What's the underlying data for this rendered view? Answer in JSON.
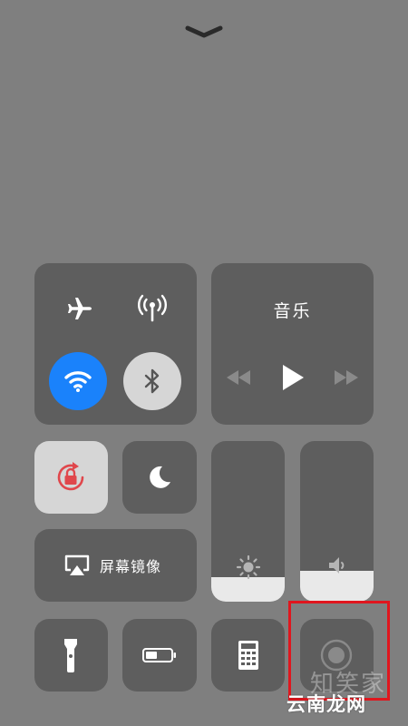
{
  "control_center": {
    "handle_icon": "chevron-down-icon",
    "connectivity": {
      "airplane_icon": "airplane-icon",
      "cellular_icon": "antenna-icon",
      "wifi_icon": "wifi-icon",
      "bluetooth_icon": "bluetooth-icon",
      "wifi_on_color": "#1a82fb"
    },
    "music": {
      "title": "音乐",
      "prev_icon": "rewind-icon",
      "play_icon": "play-icon",
      "next_icon": "fast-forward-icon"
    },
    "rotation_lock_icon": "rotation-lock-icon",
    "do_not_disturb_icon": "moon-icon",
    "screen_mirroring": {
      "icon": "airplay-icon",
      "label": "屏幕镜像"
    },
    "brightness": {
      "icon": "sun-icon",
      "level": 0.15
    },
    "volume": {
      "icon": "speaker-icon",
      "level": 0.19
    },
    "bottom_row": {
      "flashlight_icon": "flashlight-icon",
      "battery_icon": "battery-icon",
      "calculator_icon": "calculator-icon",
      "screen_record_icon": "record-icon"
    }
  },
  "watermark": {
    "faint_text": "知笑家",
    "text": "云南龙网"
  },
  "highlight_color": "#e0161e"
}
